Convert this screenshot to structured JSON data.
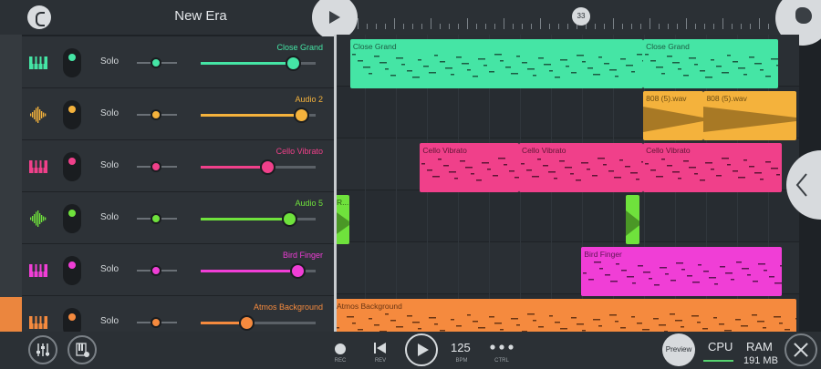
{
  "project": {
    "title": "New Era"
  },
  "timeline": {
    "marker": "33"
  },
  "tracks": [
    {
      "name": "Close Grand",
      "solo": "Solo",
      "icon": "piano-icon",
      "color": "#45e5a5",
      "pan": 0.4,
      "volume": 0.8
    },
    {
      "name": "Audio 2",
      "solo": "Solo",
      "icon": "waveform-icon",
      "color": "#f4b23c",
      "pan": 0.4,
      "volume": 0.87
    },
    {
      "name": "Cello Vibrato",
      "solo": "Solo",
      "icon": "piano-icon",
      "color": "#f0408a",
      "pan": 0.4,
      "volume": 0.58
    },
    {
      "name": "Audio 5",
      "solo": "Solo",
      "icon": "waveform-icon",
      "color": "#6fe23c",
      "pan": 0.4,
      "volume": 0.77
    },
    {
      "name": "Bird Finger",
      "solo": "Solo",
      "icon": "piano-icon",
      "color": "#f03ed6",
      "pan": 0.4,
      "volume": 0.84
    },
    {
      "name": "Atmos Background",
      "solo": "Solo",
      "icon": "piano-icon",
      "color": "#f58a3e",
      "pan": 0.4,
      "volume": 0.4
    }
  ],
  "clips": [
    {
      "lane": 0,
      "label": "Close Grand",
      "color": "#45e5a5",
      "text": "#1d5c43",
      "start": 0.035,
      "end": 0.665,
      "kind": "notes"
    },
    {
      "lane": 0,
      "label": "Close Grand",
      "color": "#45e5a5",
      "text": "#1d5c43",
      "start": 0.665,
      "end": 0.955,
      "kind": "notes"
    },
    {
      "lane": 1,
      "label": "808 (5).wav",
      "color": "#f4b23c",
      "text": "#6a4b12",
      "start": 0.665,
      "end": 0.795,
      "kind": "wave"
    },
    {
      "lane": 1,
      "label": "808 (5).wav",
      "color": "#f4b23c",
      "text": "#6a4b12",
      "start": 0.795,
      "end": 0.995,
      "kind": "wave"
    },
    {
      "lane": 2,
      "label": "Cello Vibrato",
      "color": "#f0408a",
      "text": "#5e1535",
      "start": 0.185,
      "end": 0.398,
      "kind": "notes"
    },
    {
      "lane": 2,
      "label": "Cello Vibrato",
      "color": "#f0408a",
      "text": "#5e1535",
      "start": 0.398,
      "end": 0.665,
      "kind": "notes"
    },
    {
      "lane": 2,
      "label": "Cello Vibrato",
      "color": "#f0408a",
      "text": "#5e1535",
      "start": 0.665,
      "end": 0.962,
      "kind": "notes"
    },
    {
      "lane": 3,
      "label": "R...",
      "color": "#6fe23c",
      "text": "#2b5a14",
      "start": 0.0,
      "end": 0.033,
      "kind": "wave"
    },
    {
      "lane": 3,
      "label": "",
      "color": "#6fe23c",
      "text": "#2b5a14",
      "start": 0.627,
      "end": 0.657,
      "kind": "wave"
    },
    {
      "lane": 4,
      "label": "Bird Finger",
      "color": "#f03ed6",
      "text": "#5e1454",
      "start": 0.532,
      "end": 0.962,
      "kind": "notes"
    },
    {
      "lane": 5,
      "label": "Atmos Background",
      "color": "#f58a3e",
      "text": "#6a3513",
      "start": 0.0,
      "end": 0.995,
      "kind": "notes"
    }
  ],
  "transport": {
    "rec": "REC",
    "rev": "REV",
    "bpm_value": "125",
    "bpm": "BPM",
    "ctrl": "CTRL",
    "preview": "Preview",
    "cpu": "CPU",
    "ram": "RAM",
    "ram_value": "191 MB"
  }
}
